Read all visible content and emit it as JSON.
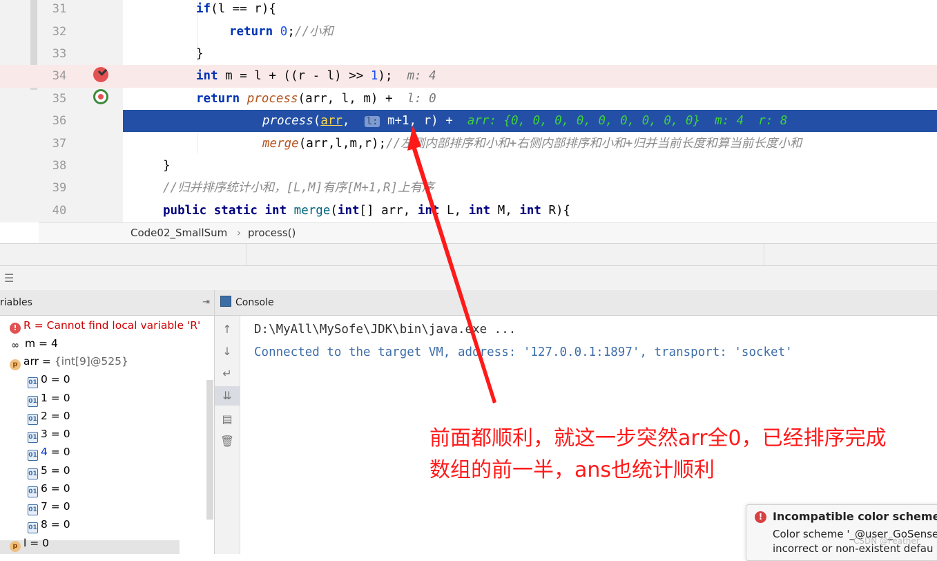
{
  "editor": {
    "lines": [
      {
        "num": "31"
      },
      {
        "num": "32"
      },
      {
        "num": "33"
      },
      {
        "num": "34",
        "hint": "m: 4"
      },
      {
        "num": "35",
        "hint": "l: 0"
      },
      {
        "num": "36",
        "hint": "arr: {0, 0, 0, 0, 0, 0, 0, 0, 0}  m: 4  r: 8"
      },
      {
        "num": "37"
      },
      {
        "num": "38"
      },
      {
        "num": "39"
      },
      {
        "num": "40"
      }
    ],
    "code": {
      "l31_kw": "if",
      "l31_rest": "(l == r){",
      "l32_kw": "return",
      "l32_num": "0",
      "l32_rest": ";",
      "l32_cmt": "//小和",
      "l33": "}",
      "l34_kw": "int",
      "l34_a": " m = l + ((r - l) >> ",
      "l34_num": "1",
      "l34_b": ");",
      "l35_kw": "return",
      "l35_fn": "process",
      "l35_rest": "(arr, l, m) +",
      "l36_fn": "process",
      "l36_p": "(",
      "l36_arr": "arr",
      "l36_comma": ", ",
      "l36_l": "l:",
      "l36_rest": " m+1, r) +",
      "l37_fn": "merge",
      "l37_rest": "(arr,l,m,r);",
      "l37_cmt": "//左侧内部排序和小和+右侧内部排序和小和+归并当前长度和算当前长度小和",
      "l38": "}",
      "l39_cmt": "//归并排序统计小和，[L,M]有序[M+1,R]上有序",
      "l40_kw1": "public static int",
      "l40_fn": "merge",
      "l40_a": "(",
      "l40_kw2": "int",
      "l40_b": "[] arr, ",
      "l40_kw3": "int",
      "l40_c": " L, ",
      "l40_kw4": "int",
      "l40_d": " M, ",
      "l40_kw5": "int",
      "l40_e": " R){"
    }
  },
  "breadcrumb": {
    "file": "Code02_SmallSum",
    "sep": "›",
    "method": "process()"
  },
  "variables": {
    "title": "riables",
    "pin": "⇥",
    "items": [
      {
        "name": "R",
        "eq": " = ",
        "value": "Cannot find local variable 'R'"
      },
      {
        "name": "m",
        "eq": " = ",
        "value": "4"
      },
      {
        "name": "arr",
        "eq": " = ",
        "value": "{int[9]@525}"
      },
      {
        "name": "0",
        "eq": " = ",
        "value": "0"
      },
      {
        "name": "1",
        "eq": " = ",
        "value": "0"
      },
      {
        "name": "2",
        "eq": " = ",
        "value": "0"
      },
      {
        "name": "3",
        "eq": " = ",
        "value": "0"
      },
      {
        "name": "4",
        "eq": " = ",
        "value": "0"
      },
      {
        "name": "5",
        "eq": " = ",
        "value": "0"
      },
      {
        "name": "6",
        "eq": " = ",
        "value": "0"
      },
      {
        "name": "7",
        "eq": " = ",
        "value": "0"
      },
      {
        "name": "8",
        "eq": " = ",
        "value": "0"
      },
      {
        "name": "l",
        "eq": " = ",
        "value": "0"
      }
    ]
  },
  "console": {
    "title": "Console",
    "lines": [
      "D:\\MyAll\\MySofe\\JDK\\bin\\java.exe ...",
      "Connected to the target VM, address: '127.0.0.1:1897', transport: 'socket'"
    ]
  },
  "annotation": {
    "line1": "前面都顺利，就这一步突然arr全0，已经排序完成",
    "line2": "数组的前一半，ans也统计顺利",
    "color": "#ff1a1a"
  },
  "notification": {
    "title": "Incompatible color scheme",
    "line1": "Color scheme '_@user_GoSense",
    "line2": "incorrect or non-existent defau"
  },
  "watermark": "CSDN @Feather",
  "colors": {
    "current_line": "#2350a6",
    "breakpoint_line": "#fae9e9",
    "keyword": "#0033b3",
    "debug_hint": "#22c322"
  }
}
